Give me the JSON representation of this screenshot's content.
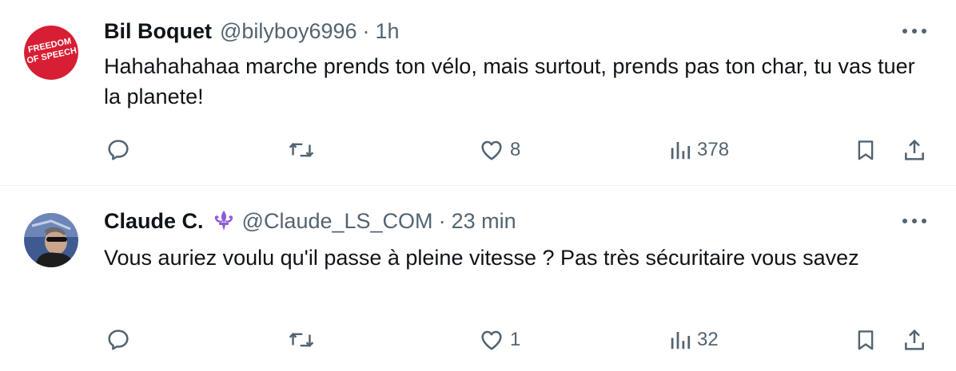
{
  "tweets": [
    {
      "avatar_text_line1": "FREEDOM",
      "avatar_text_line2": "OF SPEECH",
      "name": "Bil Boquet",
      "handle": "@bilyboy6996",
      "separator": "·",
      "time": "1h",
      "text": "Hahahahahaa marche prends ton vélo, mais surtout, prends pas ton char, tu vas tuer la planete!",
      "likes": "8",
      "views": "378",
      "colors": {
        "avatar_bg": "#d81e34"
      }
    },
    {
      "name": "Claude C.",
      "badge_icon": "fleur-de-lis-icon",
      "handle": "@Claude_LS_COM",
      "separator": "·",
      "time": "23 min",
      "text": "Vous auriez voulu qu'il passe à pleine vitesse ? Pas très sécuritaire vous savez",
      "likes": "1",
      "views": "32",
      "colors": {
        "badge": "#8e5bd6"
      }
    }
  ],
  "icons": {
    "reply": "reply-icon",
    "retweet": "retweet-icon",
    "like": "heart-icon",
    "views": "views-icon",
    "bookmark": "bookmark-icon",
    "share": "share-icon",
    "more": "more-icon"
  }
}
